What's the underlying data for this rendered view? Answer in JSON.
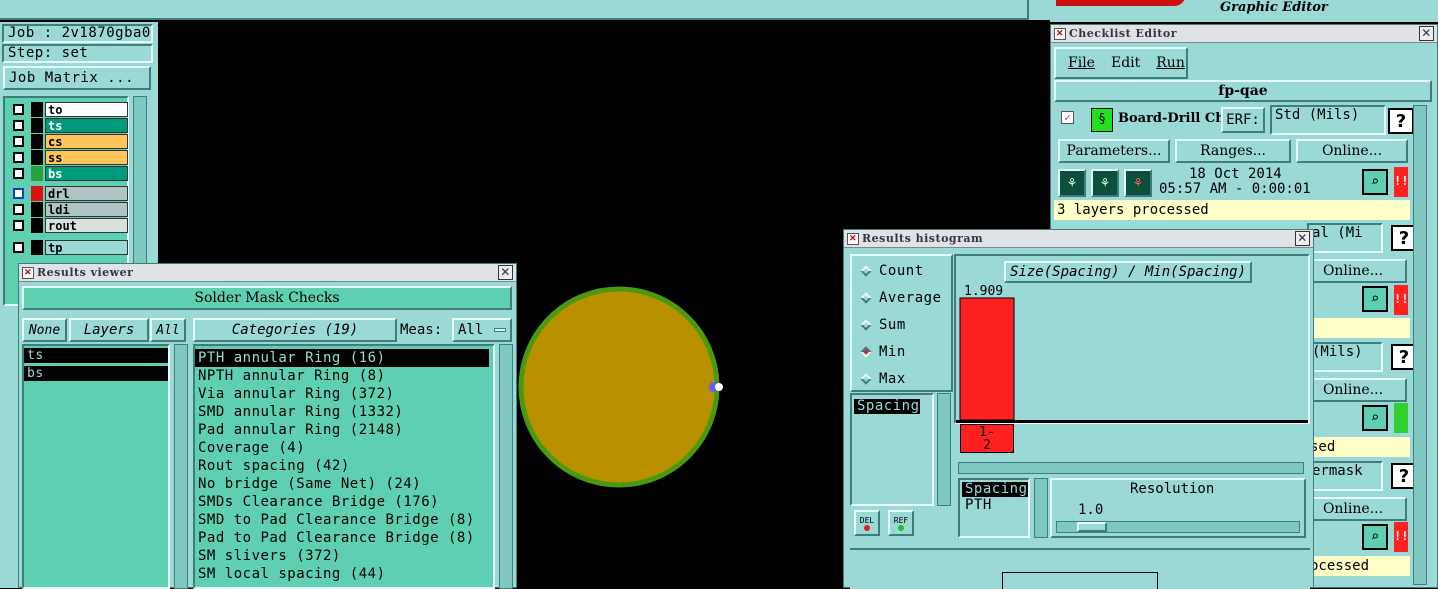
{
  "app": {
    "brand_title": "Graphic Editor"
  },
  "job_panel": {
    "job_label": "Job : 2v1870gba0",
    "step_label": "Step: set",
    "job_matrix_button": "Job Matrix ...",
    "layers": [
      {
        "name": "to",
        "color": "#ffffff"
      },
      {
        "name": "ts",
        "color": "#00997a"
      },
      {
        "name": "cs",
        "color": "#ffc55a"
      },
      {
        "name": "ss",
        "color": "#ffc55a"
      },
      {
        "name": "bs",
        "color": "#00997a"
      },
      {
        "name": "drl",
        "color": "#b0c4c6"
      },
      {
        "name": "ldi",
        "color": "#b0c4c6"
      },
      {
        "name": "rout",
        "color": "#d8e0e0"
      },
      {
        "name": "tp",
        "color": "#9bd9d6"
      }
    ]
  },
  "results_viewer": {
    "title": "Results viewer",
    "group_title": "Solder Mask Checks",
    "none_button": "None",
    "layers_header": "Layers",
    "all_button": "All",
    "categories_header": "Categories (19)",
    "meas_label": "Meas:",
    "meas_value": "All",
    "layer_items": [
      "ts",
      "bs"
    ],
    "categories": [
      "PTH annular Ring (16)",
      "NPTH annular Ring (8)",
      "Via annular Ring (372)",
      "SMD annular Ring (1332)",
      "Pad annular Ring (2148)",
      "Coverage (4)",
      "Rout spacing (42)",
      "No bridge (Same Net) (24)",
      "SMDs Clearance Bridge (176)",
      "SMD to Pad Clearance Bridge (8)",
      "Pad to Pad Clearance Bridge (8)",
      "SM slivers (372)",
      "SM local spacing (44)"
    ]
  },
  "checklist_editor": {
    "title": "Checklist Editor",
    "menu": [
      "File",
      "Edit",
      "Run"
    ],
    "checklist_name": "fp-qae",
    "check_name": "Board-Drill Che",
    "erf_button": "ERF:",
    "units": "Std (Mils)",
    "parameters_button": "Parameters...",
    "ranges_button": "Ranges...",
    "online_button": "Online...",
    "date": "18 Oct 2014",
    "time": "05:57 AM - 0:00:01",
    "status": "3 layers processed",
    "partial_units_2": "al (Mi",
    "partial_units_3": "(Mils)",
    "partial_status_2": "sed",
    "partial_name_4": "ermask",
    "partial_status_4": "ocessed",
    "alert": "!!"
  },
  "histogram": {
    "title": "Results histogram",
    "modes": [
      {
        "label": "Count",
        "selected": false
      },
      {
        "label": "Average",
        "selected": false
      },
      {
        "label": "Sum",
        "selected": false
      },
      {
        "label": "Min",
        "selected": true
      },
      {
        "label": "Max",
        "selected": false
      }
    ],
    "chart_title": "Size(Spacing) / Min(Spacing)",
    "list_items": [
      "Spacing"
    ],
    "del_button": "DEL",
    "ref_button": "REF",
    "detail_items": [
      "Spacing",
      "PTH"
    ],
    "resolution_label": "Resolution",
    "resolution_value": "1.0"
  },
  "chart_data": {
    "type": "bar",
    "title": "Size(Spacing) / Min(Spacing)",
    "categories": [
      "1-2"
    ],
    "values": [
      1.909
    ],
    "data_labels": [
      "1.909"
    ],
    "bar_color": "#ff2020"
  },
  "canvas": {
    "pad_fill": "#b89000",
    "pad_ring": "#4a9a10"
  }
}
